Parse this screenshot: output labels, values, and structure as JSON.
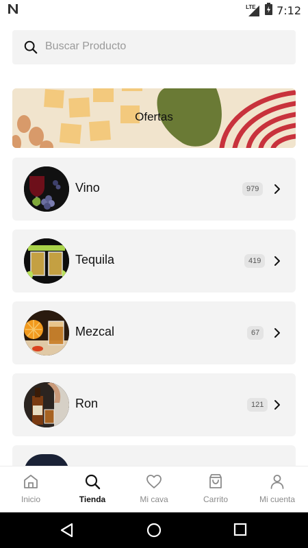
{
  "status_bar": {
    "time": "7:12",
    "network": "LTE"
  },
  "search": {
    "placeholder": "Buscar Producto"
  },
  "banner": {
    "title": "Ofertas"
  },
  "categories": [
    {
      "label": "Vino",
      "count": "979"
    },
    {
      "label": "Tequila",
      "count": "419"
    },
    {
      "label": "Mezcal",
      "count": "67"
    },
    {
      "label": "Ron",
      "count": "121"
    }
  ],
  "bottom_nav": {
    "items": [
      {
        "label": "Inicio",
        "icon": "home-icon"
      },
      {
        "label": "Tienda",
        "icon": "search-icon",
        "active": true
      },
      {
        "label": "Mi cava",
        "icon": "heart-icon"
      },
      {
        "label": "Carrito",
        "icon": "bag-icon"
      },
      {
        "label": "Mi cuenta",
        "icon": "user-icon"
      }
    ]
  },
  "colors": {
    "card_bg": "#f3f3f3",
    "banner_bg": "#f1e4cd",
    "banner_accent": "#6a7a35",
    "banner_red": "#c8323c"
  }
}
